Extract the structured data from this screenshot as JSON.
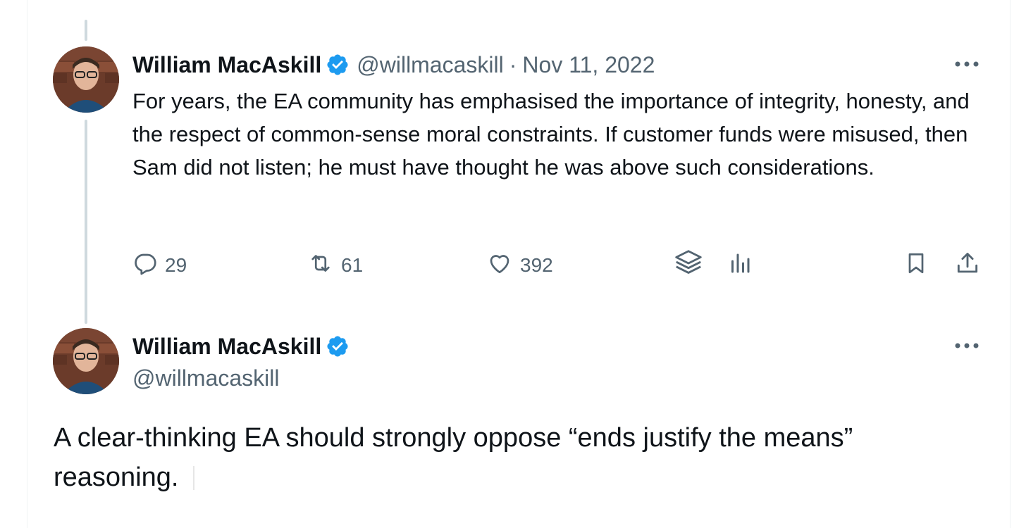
{
  "tweet1": {
    "author_name": "William MacAskill",
    "handle": "@willmacaskill",
    "separator": "·",
    "date": "Nov 11, 2022",
    "text": "For years, the EA community has emphasised the importance of integrity, honesty, and the respect of common-sense moral constraints. If customer funds were misused, then Sam did not listen; he must have thought he was above such considerations.",
    "replies": "29",
    "reposts": "61",
    "likes": "392",
    "icons": [
      "reply-icon",
      "repost-icon",
      "like-icon",
      "grok-icon",
      "views-icon",
      "bookmark-icon",
      "share-icon",
      "more-icon",
      "verified-badge-icon"
    ]
  },
  "tweet2": {
    "author_name": "William MacAskill",
    "handle": "@willmacaskill",
    "text": "A clear-thinking EA should strongly oppose “ends justify the means” reasoning."
  },
  "colors": {
    "text": "#0f1419",
    "secondary": "#536471",
    "verified": "#1d9bf0",
    "thread_line": "#cfd9de"
  }
}
